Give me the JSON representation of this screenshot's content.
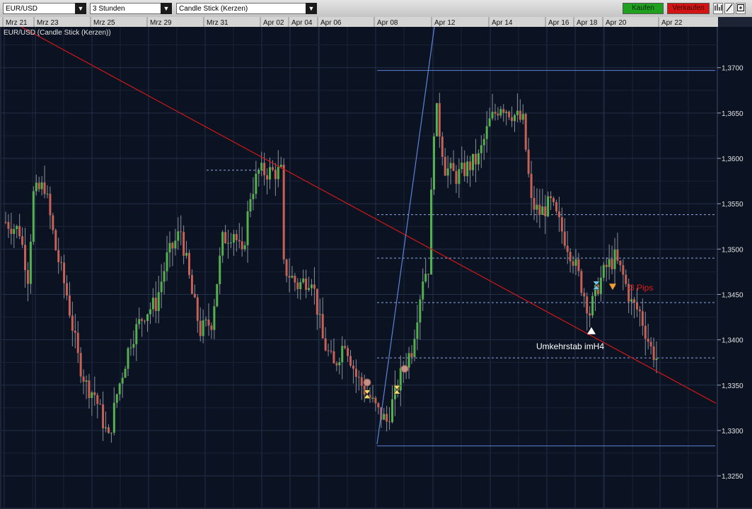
{
  "toolbar": {
    "symbol": "EUR/USD",
    "period": "3 Stunden",
    "chart_style": "Candle Stick (Kerzen)",
    "buy_label": "Kaufen",
    "sell_label": "Verkaufen",
    "icons": [
      "bar-chart-icon",
      "draw-line-icon",
      "expand-icon"
    ]
  },
  "colors": {
    "background": "#0b1221",
    "grid": "#23304a",
    "bull": "#54b24e",
    "bear": "#c76055",
    "trendline": "#d01818",
    "channel": "#5f82d8",
    "level": "#8ea6e4",
    "annotation_red": "#e01c1c"
  },
  "chart_data": {
    "type": "candlestick",
    "title": "EUR/USD (Candle Stick (Kerzen))",
    "xlabel": "",
    "ylabel": "",
    "x_ticks": [
      "Mrz 21",
      "Mrz 23",
      "Mrz 25",
      "Mrz 29",
      "Mrz 31",
      "Apr 02",
      "Apr 04",
      "Apr 06",
      "Apr 08",
      "Apr 12",
      "Apr 14",
      "Apr 16",
      "Apr 18",
      "Apr 20",
      "Apr 22"
    ],
    "y_ticks": [
      "1,3250",
      "1,3300",
      "1,3350",
      "1,3400",
      "1,3450",
      "1,3500",
      "1,3550",
      "1,3600",
      "1,3650",
      "1,3700"
    ],
    "ylim": [
      1.3215,
      1.3745
    ],
    "grid": true,
    "candles": {
      "keyframes": [
        [
          0,
          1.353
        ],
        [
          5,
          1.352
        ],
        [
          8,
          1.347
        ],
        [
          10,
          1.356
        ],
        [
          14,
          1.357
        ],
        [
          18,
          1.35
        ],
        [
          22,
          1.345
        ],
        [
          26,
          1.338
        ],
        [
          29,
          1.335
        ],
        [
          32,
          1.334
        ],
        [
          37,
          1.329
        ],
        [
          40,
          1.334
        ],
        [
          45,
          1.34
        ],
        [
          50,
          1.343
        ],
        [
          54,
          1.344
        ],
        [
          58,
          1.349
        ],
        [
          63,
          1.352
        ],
        [
          67,
          1.345
        ],
        [
          70,
          1.341
        ],
        [
          74,
          1.342
        ],
        [
          78,
          1.351
        ],
        [
          82,
          1.352
        ],
        [
          85,
          1.349
        ],
        [
          88,
          1.356
        ],
        [
          91,
          1.3585
        ],
        [
          99,
          1.3585
        ],
        [
          100,
          1.348
        ],
        [
          105,
          1.346
        ],
        [
          110,
          1.347
        ],
        [
          114,
          1.34
        ],
        [
          118,
          1.337
        ],
        [
          122,
          1.34
        ],
        [
          126,
          1.336
        ],
        [
          130,
          1.334
        ],
        [
          134,
          1.332
        ],
        [
          137,
          1.331
        ],
        [
          140,
          1.334
        ],
        [
          143,
          1.337
        ],
        [
          146,
          1.339
        ],
        [
          150,
          1.347
        ],
        [
          152,
          1.348
        ],
        [
          154,
          1.3635
        ],
        [
          155,
          1.365
        ],
        [
          158,
          1.359
        ],
        [
          162,
          1.358
        ],
        [
          166,
          1.359
        ],
        [
          170,
          1.36
        ],
        [
          174,
          1.364
        ],
        [
          178,
          1.366
        ],
        [
          182,
          1.365
        ],
        [
          186,
          1.364
        ],
        [
          189,
          1.355
        ],
        [
          192,
          1.354
        ],
        [
          196,
          1.355
        ],
        [
          200,
          1.352
        ],
        [
          204,
          1.349
        ],
        [
          208,
          1.345
        ],
        [
          210,
          1.343
        ],
        [
          213,
          1.346
        ],
        [
          216,
          1.348
        ],
        [
          219,
          1.349
        ],
        [
          222,
          1.347
        ],
        [
          225,
          1.344
        ],
        [
          228,
          1.343
        ],
        [
          230,
          1.341
        ],
        [
          232,
          1.339
        ],
        [
          234,
          1.338
        ]
      ],
      "first_candle_date": "Mrz 21",
      "last_candle_date": "Apr 22",
      "interval": "3 Stunden"
    },
    "trendlines": [
      {
        "name": "red-downtrend",
        "from": [
          "Mrz 22",
          1.3745
        ],
        "to": [
          "Apr 22",
          1.333
        ]
      },
      {
        "name": "blue-channel",
        "from": [
          "Apr 08",
          1.3285
        ],
        "to": [
          "Apr 12",
          1.3745
        ]
      }
    ],
    "levels": [
      {
        "value": 1.3697,
        "style": "solid",
        "from": "Apr 08"
      },
      {
        "value": 1.3538,
        "style": "dashed",
        "from": "Apr 08"
      },
      {
        "value": 1.349,
        "style": "dashed",
        "from": "Apr 08"
      },
      {
        "value": 1.3441,
        "style": "dashed",
        "from": "Apr 08"
      },
      {
        "value": 1.338,
        "style": "dashed",
        "from": "Apr 08"
      },
      {
        "value": 1.3283,
        "style": "solid",
        "from": "Apr 08"
      },
      {
        "value": 1.3587,
        "style": "dashed",
        "from": "Mrz 31",
        "to": "Apr 02"
      }
    ],
    "annotations": [
      {
        "text": "Umkehrstab imH4",
        "at": [
          "Apr 18",
          1.341
        ],
        "color": "white",
        "marker": "up-triangle"
      },
      {
        "text": "-3 Pips",
        "at": [
          "Apr 20",
          1.3458
        ],
        "color": "red",
        "marker": "down-triangle"
      }
    ],
    "markers": [
      {
        "type": "circle",
        "at": [
          "Apr 07",
          1.3353
        ]
      },
      {
        "type": "circle",
        "at": [
          "Apr 08",
          1.3368
        ]
      },
      {
        "type": "hourglass",
        "at": [
          "Apr 07",
          1.334
        ]
      },
      {
        "type": "hourglass",
        "at": [
          "Apr 08",
          1.3345
        ]
      },
      {
        "type": "hourglass",
        "at": [
          "Apr 18",
          1.346
        ]
      }
    ]
  }
}
